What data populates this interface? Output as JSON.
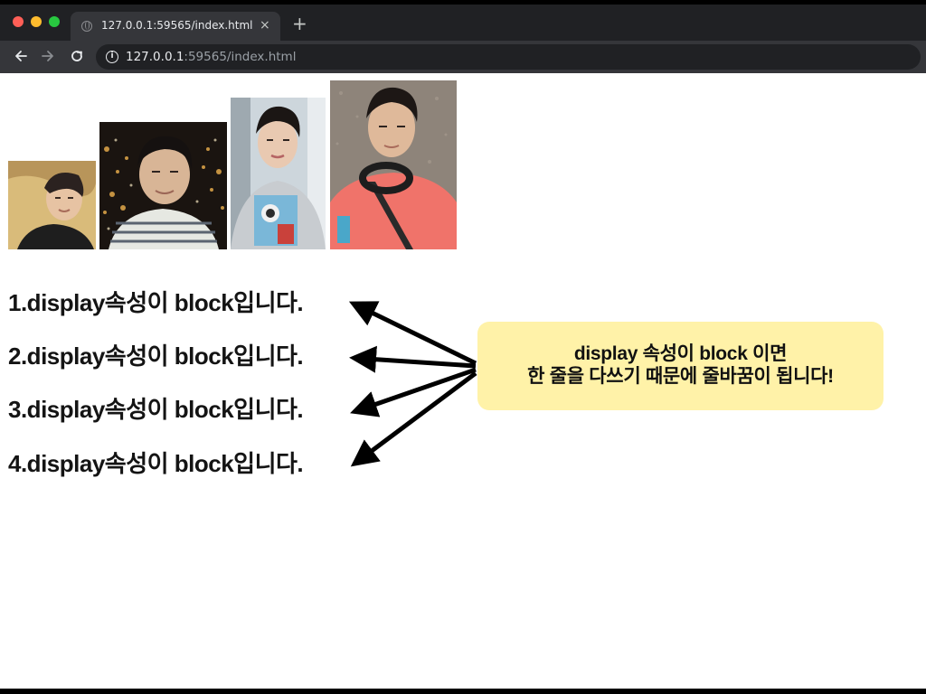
{
  "browser": {
    "tab_title": "127.0.0.1:59565/index.html",
    "url_host": "127.0.0.1",
    "url_rest": ":59565/index.html",
    "close_glyph": "×",
    "new_tab_glyph": "+",
    "info_glyph": "i"
  },
  "page": {
    "photos": [
      {
        "name": "photo-1",
        "subject": "man in black shirt lying on yellow blanket"
      },
      {
        "name": "photo-2",
        "subject": "man in striped shirt with city night lights"
      },
      {
        "name": "photo-3",
        "subject": "man in grey printed sweatshirt"
      },
      {
        "name": "photo-4",
        "subject": "man in pink sweatshirt with headphones"
      }
    ],
    "lines": [
      "1.display속성이 block입니다.",
      "2.display속성이 block입니다.",
      "3.display속성이 block입니다.",
      "4.display속성이 block입니다."
    ],
    "callout": {
      "line1": "display 속성이 block 이면",
      "line2": "한 줄을 다쓰기 때문에 줄바꿈이 됩니다!"
    }
  },
  "colors": {
    "chrome_dark": "#202124",
    "chrome_toolbar": "#35363a",
    "callout_bg": "#fff2a8",
    "arrow": "#000000"
  }
}
